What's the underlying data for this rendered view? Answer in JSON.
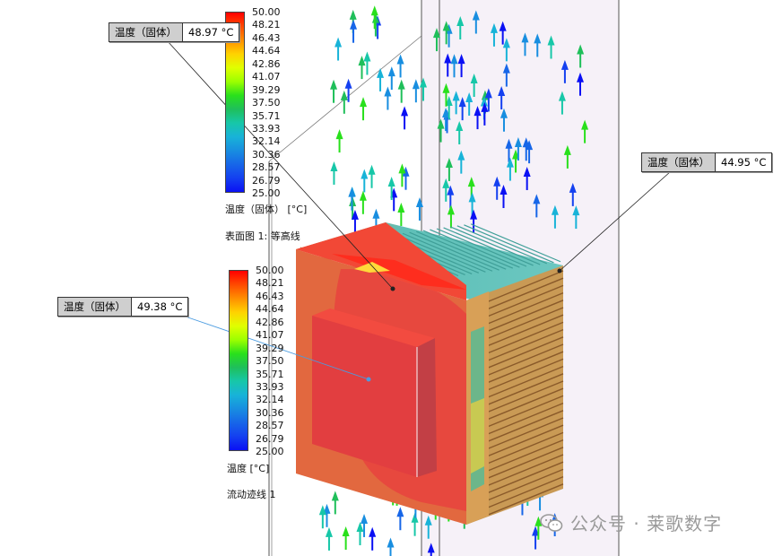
{
  "legend_top": {
    "ticks": [
      "50.00",
      "48.21",
      "46.43",
      "44.64",
      "42.86",
      "41.07",
      "39.29",
      "37.50",
      "35.71",
      "33.93",
      "32.14",
      "30.36",
      "28.57",
      "26.79",
      "25.00"
    ],
    "unit": "温度（固体） [°C]",
    "caption": "表面图 1: 等高线"
  },
  "legend_bottom": {
    "ticks": [
      "50.00",
      "48.21",
      "46.43",
      "44.64",
      "42.86",
      "41.07",
      "39.29",
      "37.50",
      "35.71",
      "33.93",
      "32.14",
      "30.36",
      "28.57",
      "26.79",
      "25.00"
    ],
    "unit": "温度 [°C]",
    "caption": "流动迹线 1"
  },
  "probes": {
    "probe1": {
      "label": "温度（固体）",
      "value": "48.97 °C"
    },
    "probe2": {
      "label": "温度（固体）",
      "value": "49.38 °C"
    },
    "probe3": {
      "label": "温度（固体）",
      "value": "44.95 °C"
    }
  },
  "colors": {
    "hot_red": "#e8433e",
    "orange": "#e2683f",
    "colormap": [
      "#ff0000",
      "#ff4a00",
      "#ff8f00",
      "#ffd200",
      "#e0ff00",
      "#9cff00",
      "#29e01c",
      "#1fbf5a",
      "#17c7a8",
      "#18b3d8",
      "#188ee0",
      "#1766e8",
      "#1440f0",
      "#0a10f4"
    ]
  },
  "icons": [
    "wechat-icon"
  ],
  "watermark": "公众号 · 莱歌数字"
}
